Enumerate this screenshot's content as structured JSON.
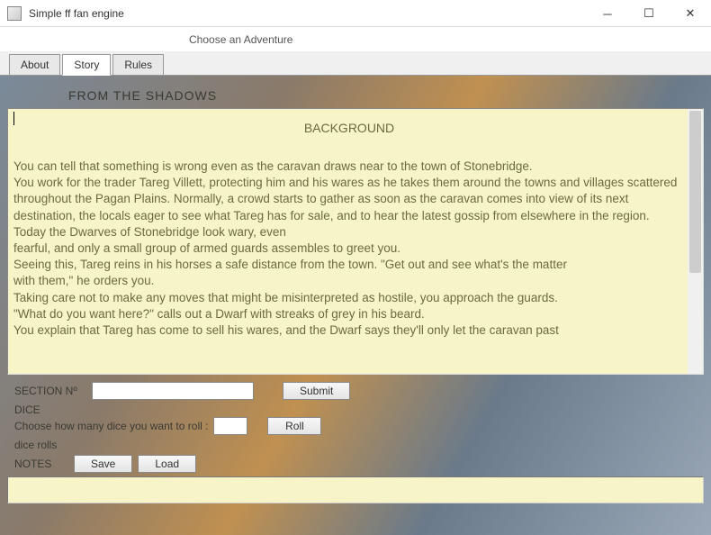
{
  "window": {
    "title": "Simple ff fan engine"
  },
  "menu": {
    "choose_adventure": "Choose an Adventure"
  },
  "tabs": {
    "about": "About",
    "story": "Story",
    "rules": "Rules"
  },
  "adventure": {
    "title": "FROM THE SHADOWS"
  },
  "story": {
    "heading": "BACKGROUND",
    "body": "You can tell that something is wrong even as the caravan draws near to the town of Stonebridge.\nYou work for the trader Tareg Villett, protecting him and his wares as he takes them around the towns and villages scattered throughout the Pagan Plains. Normally, a crowd starts to gather as soon as the caravan comes into view of its next destination, the locals eager to see what Tareg has for sale, and to hear the latest gossip from elsewhere in the region. Today the Dwarves of Stonebridge look wary, even\nfearful, and only a small group of armed guards assembles to greet you.\nSeeing this, Tareg reins in his horses a safe distance from the town. \"Get out and see what's the matter\nwith them,\" he orders you.\nTaking care not to make any moves that might be misinterpreted as hostile, you approach the guards.\n\"What do you want here?\" calls out a Dwarf with streaks of grey in his beard.\nYou explain that Tareg has come to sell his wares, and the Dwarf says they'll only let the caravan past"
  },
  "controls": {
    "section_label": "SECTION Nº",
    "section_value": "",
    "submit_label": "Submit",
    "dice_label": "DICE",
    "dice_prompt": "Choose how many dice you want to roll :",
    "dice_value": "",
    "roll_label": "Roll",
    "dice_rolls_label": "dice rolls",
    "notes_label": "NOTES",
    "save_label": "Save",
    "load_label": "Load"
  }
}
